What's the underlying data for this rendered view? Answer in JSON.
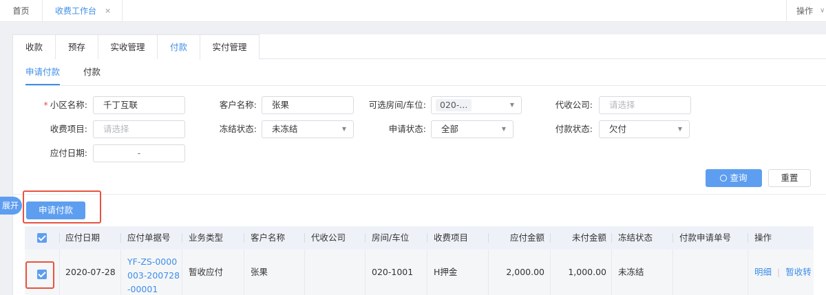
{
  "topbar": {
    "home_tab": "首页",
    "active_tab": "收费工作台",
    "close_glyph": "×",
    "ops_label": "操作",
    "ops_chevron": "∨"
  },
  "main_tabs": [
    "收款",
    "预存",
    "实收管理",
    "付款",
    "实付管理"
  ],
  "sub_tabs": [
    "申请付款",
    "付款"
  ],
  "filters": {
    "community": {
      "label": "小区名称:",
      "value": "千丁互联",
      "required_mark": "*"
    },
    "customer": {
      "label": "客户名称:",
      "value": "张果"
    },
    "rooms": {
      "label": "可选房间/车位:",
      "value": "020-..."
    },
    "agent_company": {
      "label": "代收公司:",
      "placeholder": "请选择"
    },
    "fee_item": {
      "label": "收费项目:",
      "placeholder": "请选择"
    },
    "freeze_status": {
      "label": "冻结状态:",
      "value": "未冻结"
    },
    "apply_status": {
      "label": "申请状态:",
      "value": "全部"
    },
    "pay_status": {
      "label": "付款状态:",
      "value": "欠付"
    },
    "due_date": {
      "label": "应付日期:",
      "value": "-"
    }
  },
  "buttons": {
    "query": "查询",
    "reset": "重置",
    "apply_payment": "申请付款",
    "expand": "展开"
  },
  "table": {
    "columns": [
      "应付日期",
      "应付单据号",
      "业务类型",
      "客户名称",
      "代收公司",
      "房间/车位",
      "收费项目",
      "应付金额",
      "未付金额",
      "冻结状态",
      "付款申请单号",
      "操作"
    ],
    "rows": [
      {
        "checked": true,
        "due_date": "2020-07-28",
        "doc_no_lines": [
          "YF-ZS-0000",
          "003-200728",
          "-00001"
        ],
        "biz_type": "暂收应付",
        "customer": "张果",
        "agent_company": "",
        "room": "020-1001",
        "fee_item": "H押金",
        "amount_due": "2,000.00",
        "amount_unpaid": "1,000.00",
        "freeze_status": "未冻结",
        "apply_no": "",
        "op_detail": "明细",
        "op_separator": "|",
        "op_transfer": "暂收转"
      }
    ]
  },
  "colors": {
    "accent": "#3d8ee8",
    "primary_button": "#5e9ef0",
    "highlight_box": "#e8523f",
    "required_mark": "#e84a4a"
  },
  "icons": [
    "search-icon",
    "close-icon",
    "chevron-down-icon",
    "checkbox-icon"
  ]
}
